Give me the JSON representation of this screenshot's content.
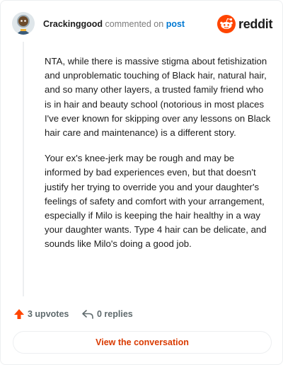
{
  "header": {
    "username": "Crackinggood",
    "action_text": "commented on",
    "post_link": "post",
    "brand_name": "reddit"
  },
  "comment": {
    "paragraphs": [
      "NTA, while there is massive stigma about fetishization and unproblematic touching of Black hair, natural hair, and so many other layers, a trusted family friend who is in hair and beauty school (notorious in most places I've ever known for skipping over any lessons on Black hair care and maintenance) is a different story.",
      "Your ex's knee-jerk may be rough and may be informed by bad experiences even, but that doesn't justify her trying to override you and your daughter's feelings of safety and comfort with your arrangement, especially if Milo is keeping the hair healthy in a way your daughter wants. Type 4 hair can be delicate, and sounds like Milo's doing a good job."
    ]
  },
  "actions": {
    "upvotes": "3 upvotes",
    "replies": "0 replies"
  },
  "footer": {
    "view_button": "View the conversation"
  },
  "icons": {
    "avatar": "avatar-astronaut-icon",
    "brand": "reddit-snoo-icon",
    "upvote": "upvote-arrow-icon",
    "reply": "reply-arrow-icon"
  },
  "colors": {
    "brand": "#ff4500",
    "link": "#0079d3",
    "button_text": "#d93a00",
    "muted": "#7c7c7c"
  }
}
